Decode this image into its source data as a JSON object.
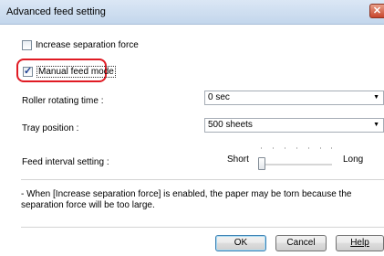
{
  "window": {
    "title": "Advanced feed setting",
    "close_glyph": "✕"
  },
  "options": {
    "increase_separation": {
      "label": "Increase separation force",
      "checked": false
    },
    "manual_feed": {
      "label": "Manual feed mode",
      "checked": true
    }
  },
  "roller": {
    "label": "Roller rotating time :",
    "value": "0 sec"
  },
  "tray": {
    "label": "Tray position :",
    "value": "500 sheets"
  },
  "feed_interval": {
    "label": "Feed interval setting :",
    "min_label": "Short",
    "max_label": "Long",
    "level": 0
  },
  "note": "- When [Increase separation force] is enabled, the paper may be torn because the separation force will be too large.",
  "buttons": {
    "ok": "OK",
    "cancel": "Cancel",
    "help": "Help"
  },
  "colors": {
    "highlight": "#e01b24",
    "title_bar": "#c3d6ec"
  },
  "icons": {
    "dropdown_arrow": "▼",
    "checkmark": "✓"
  }
}
